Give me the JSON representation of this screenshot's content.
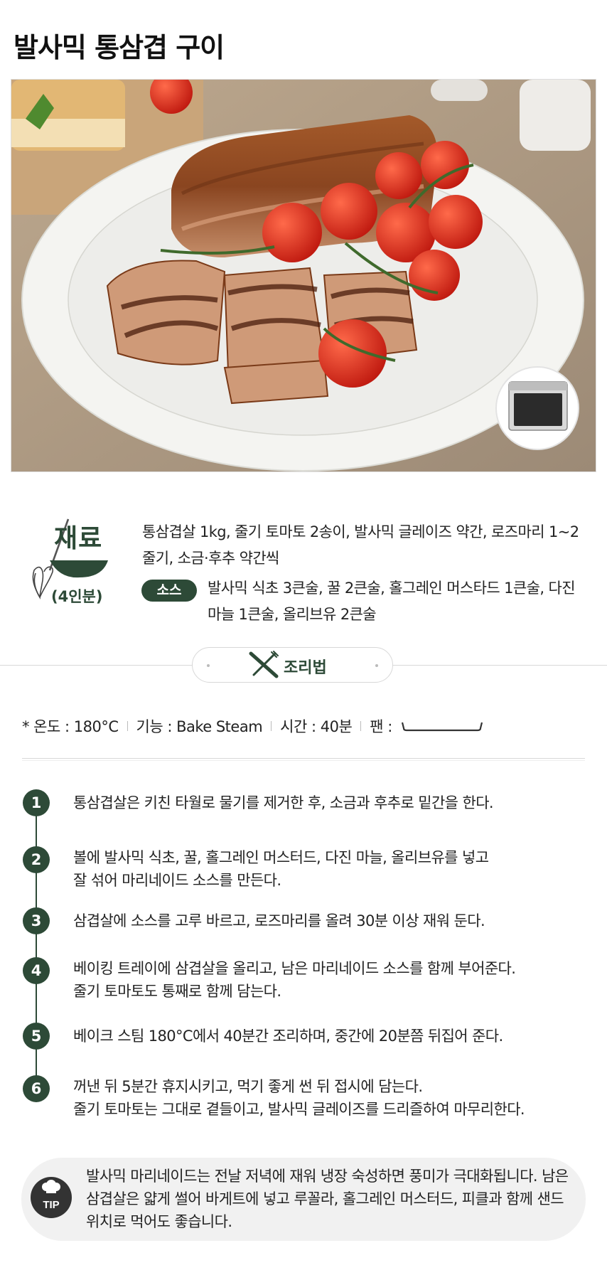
{
  "title": "발사믹 통삼겹 구이",
  "ingredients": {
    "title": "재료",
    "servings": "(4인분)",
    "main": "통삼겹살 1kg, 줄기 토마토 2송이, 발사믹 글레이즈 약간, 로즈마리 1~2줄기, 소금·후추 약간씩",
    "sauce_label": "소스",
    "sauce": "발사믹 식초 3큰술, 꿀 2큰술, 홀그레인 머스타드 1큰술, 다진 마늘 1큰술, 올리브유 2큰술"
  },
  "method": {
    "label": "조리법"
  },
  "settings": {
    "temperature": "* 온도 : 180°C",
    "function": "기능 : Bake Steam",
    "time": "시간 : 40분",
    "pan": "팬 :"
  },
  "steps": [
    {
      "num": "1",
      "text": "통삼겹살은 키친 타월로 물기를 제거한 후, 소금과 후추로 밑간을 한다."
    },
    {
      "num": "2",
      "text": "볼에 발사믹 식초, 꿀, 홀그레인 머스터드, 다진 마늘, 올리브유를 넣고\n잘 섞어 마리네이드 소스를 만든다."
    },
    {
      "num": "3",
      "text": "삼겹살에 소스를 고루 바르고, 로즈마리를 올려 30분 이상 재워 둔다."
    },
    {
      "num": "4",
      "text": "베이킹 트레이에 삼겹살을 올리고, 남은 마리네이드 소스를 함께 부어준다.\n줄기 토마토도 통째로 함께 담는다."
    },
    {
      "num": "5",
      "text": "베이크 스팀 180°C에서 40분간 조리하며, 중간에 20분쯤 뒤집어 준다."
    },
    {
      "num": "6",
      "text": "꺼낸 뒤 5분간 휴지시키고, 먹기 좋게 썬 뒤 접시에 담는다.\n줄기 토마토는 그대로 곁들이고, 발사믹 글레이즈를 드리즐하여 마무리한다."
    }
  ],
  "tip": {
    "icon_label": "TIP",
    "text": "발사믹 마리네이드는 전날 저녁에 재워 냉장 숙성하면 풍미가 극대화됩니다. 남은 삼겹살은 얇게 썰어 바게트에 넣고 루꼴라, 홀그레인 머스터드, 피클과 함께 샌드위치로 먹어도 좋습니다."
  },
  "colors": {
    "accent": "#2d4a37",
    "tip_background": "#f1f1f1",
    "divider": "#d8d8d8"
  },
  "icons": [
    "whisk-bowl-icon",
    "knife-fork-icon",
    "baking-pan-icon",
    "chef-tip-icon",
    "oven-badge"
  ]
}
